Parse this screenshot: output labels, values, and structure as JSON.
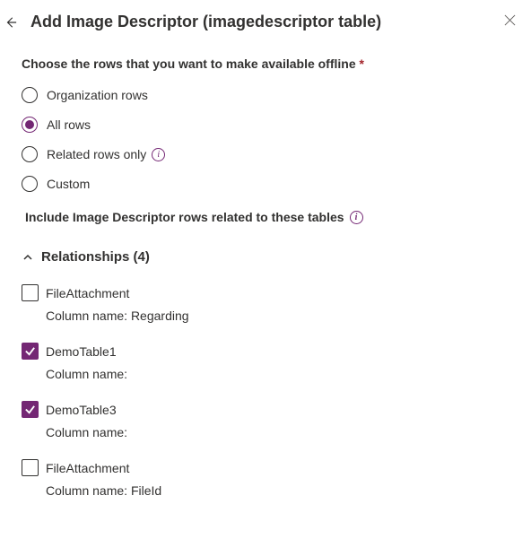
{
  "header": {
    "title": "Add Image Descriptor (imagedescriptor table)"
  },
  "prompt": "Choose the rows that you want to make available offline",
  "required_mark": "*",
  "radio": {
    "options": [
      {
        "label": "Organization rows",
        "selected": false,
        "info": false
      },
      {
        "label": "All rows",
        "selected": true,
        "info": false
      },
      {
        "label": "Related rows only",
        "selected": false,
        "info": true
      },
      {
        "label": "Custom",
        "selected": false,
        "info": false
      }
    ]
  },
  "section": {
    "label": "Include Image Descriptor rows related to these tables"
  },
  "accordion": {
    "label": "Relationships (4)",
    "expanded": true
  },
  "column_prefix": "Column name:",
  "relationships": [
    {
      "label": "FileAttachment",
      "checked": false,
      "column": "Regarding"
    },
    {
      "label": "DemoTable1",
      "checked": true,
      "column": ""
    },
    {
      "label": "DemoTable3",
      "checked": true,
      "column": ""
    },
    {
      "label": "FileAttachment",
      "checked": false,
      "column": "FileId"
    }
  ]
}
